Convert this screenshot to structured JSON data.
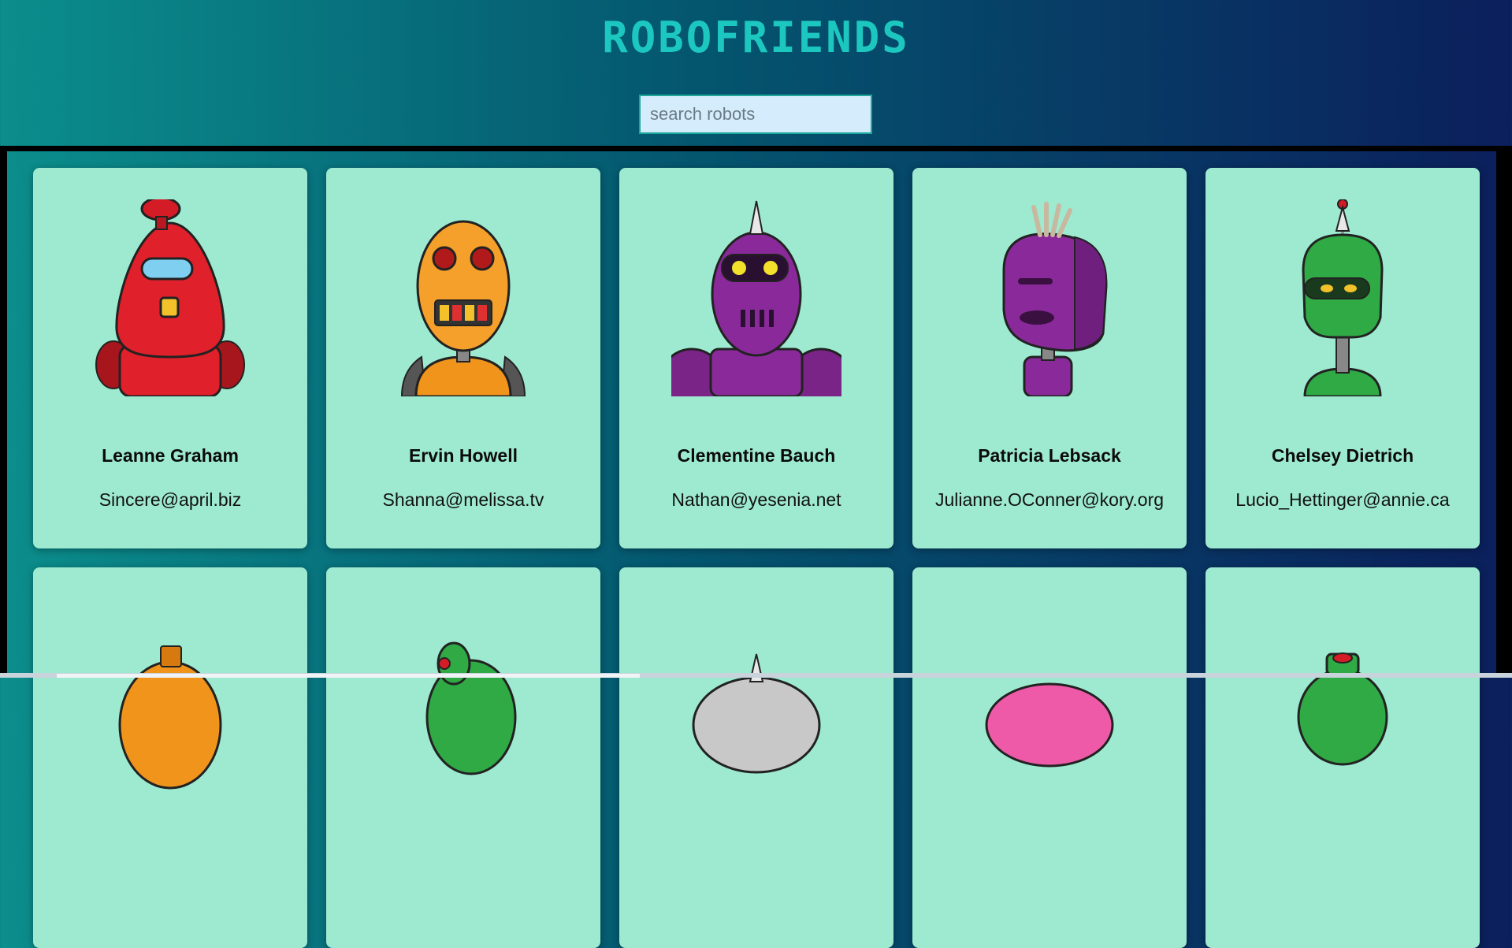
{
  "app": {
    "title": "ROBOFRIENDS"
  },
  "search": {
    "placeholder": "search robots",
    "value": ""
  },
  "robots": [
    {
      "name": "Leanne Graham",
      "email": "Sincere@april.biz",
      "color": "#e0202a"
    },
    {
      "name": "Ervin Howell",
      "email": "Shanna@melissa.tv",
      "color": "#f0941c"
    },
    {
      "name": "Clementine Bauch",
      "email": "Nathan@yesenia.net",
      "color": "#8a2a9a"
    },
    {
      "name": "Patricia Lebsack",
      "email": "Julianne.OConner@kory.org",
      "color": "#8a2a9a"
    },
    {
      "name": "Chelsey Dietrich",
      "email": "Lucio_Hettinger@annie.ca",
      "color": "#2faa45"
    },
    {
      "name": "",
      "email": "",
      "color": "#f0941c"
    },
    {
      "name": "",
      "email": "",
      "color": "#2faa45"
    },
    {
      "name": "",
      "email": "",
      "color": "#c8c8c8"
    },
    {
      "name": "",
      "email": "",
      "color": "#ee5aa8"
    },
    {
      "name": "",
      "email": "",
      "color": "#2faa45"
    }
  ]
}
